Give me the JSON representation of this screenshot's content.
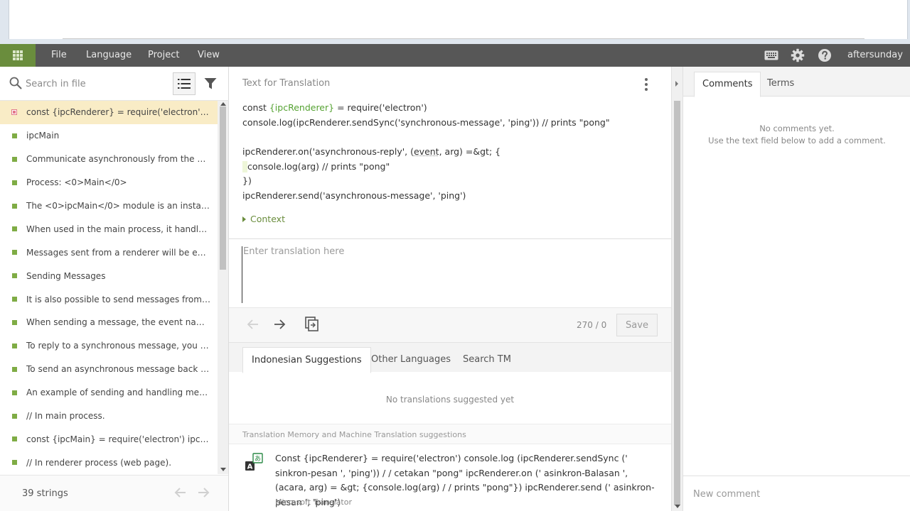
{
  "menubar": {
    "items": [
      "File",
      "Language",
      "Project",
      "View"
    ],
    "user": "aftersunday",
    "icons": [
      "keyboard-icon",
      "gear-icon",
      "help-icon"
    ]
  },
  "left": {
    "search_placeholder": "Search in file",
    "strings": [
      {
        "text": "const {ipcRenderer} = require('electron') console.log(ipcRenderer.sendSync",
        "status": "untranslated"
      },
      {
        "text": "ipcMain",
        "status": "translated"
      },
      {
        "text": "Communicate asynchronously from the main process to renderer processes.",
        "status": "translated"
      },
      {
        "text": "Process: <0>Main</0>",
        "status": "translated"
      },
      {
        "text": "The <0>ipcMain</0> module is an instance of the EventEmitter class.",
        "status": "translated"
      },
      {
        "text": "When used in the main process, it handles asynchronous and synchronous messages",
        "status": "translated"
      },
      {
        "text": "Messages sent from a renderer will be emitted to this module.",
        "status": "translated"
      },
      {
        "text": "Sending Messages",
        "status": "translated"
      },
      {
        "text": "It is also possible to send messages from the main process to the renderer",
        "status": "translated"
      },
      {
        "text": "When sending a message, the event name is the channel.",
        "status": "translated"
      },
      {
        "text": "To reply to a synchronous message, you need to set event.returnValue.",
        "status": "translated"
      },
      {
        "text": "To send an asynchronous message back to the sender, you can use",
        "status": "translated"
      },
      {
        "text": "An example of sending and handling messages between the render and main",
        "status": "translated"
      },
      {
        "text": "// In main process.",
        "status": "translated"
      },
      {
        "text": "const {ipcMain} = require('electron') ipcMain.on('asynchronous-message'",
        "status": "translated"
      },
      {
        "text": "// In renderer process (web page).",
        "status": "translated"
      }
    ],
    "count": "39 strings"
  },
  "center": {
    "header": "Text for Translation",
    "source": {
      "l1_pre": "const ",
      "l1_var": "{ipcRenderer}",
      "l1_post": " = require('electron')",
      "l2": "console.log(ipcRenderer.sendSync('synchronous-message', 'ping')) // prints \"pong\"",
      "l4_pre": "ipcRenderer.on('asynchronous-reply', (",
      "l4_var": "event",
      "l4_post": ", arg) =&gt; {",
      "l5": "console.log(arg) // prints \"pong\"",
      "l6": "})",
      "l7": "ipcRenderer.send('asynchronous-message', 'ping')"
    },
    "context_label": "Context",
    "translation_placeholder": "Enter translation here",
    "char_count": "270 / 0",
    "save_label": "Save",
    "tabs": [
      "Indonesian Suggestions",
      "Other Languages",
      "Search TM"
    ],
    "no_suggestions": "No translations suggested yet",
    "tm_label": "Translation Memory and Machine Translation suggestions",
    "suggestion_text": "Const {ipcRenderer} = require('electron') console.log (ipcRenderer.sendSync (' sinkron-pesan ', 'ping')) / / cetakan \"pong\" ipcRenderer.on (' asinkron-Balasan ', (acara, arg) = &gt; {console.log(arg) / / prints \"pong\"}) ipcRenderer.send (' asinkron-pesan ', 'ping')",
    "suggestion_source": "Microsoft Translator"
  },
  "right": {
    "tabs": [
      "Comments",
      "Terms"
    ],
    "no_comments_1": "No comments yet.",
    "no_comments_2": "Use the text field below to add a comment.",
    "comment_placeholder": "New comment"
  },
  "colors": {
    "accent_green": "#6a8d3d",
    "menubar_bg": "#575757",
    "active_row": "#f9ecc6",
    "translated_dot": "#7fac45",
    "untranslated_dot": "#e3788a"
  }
}
